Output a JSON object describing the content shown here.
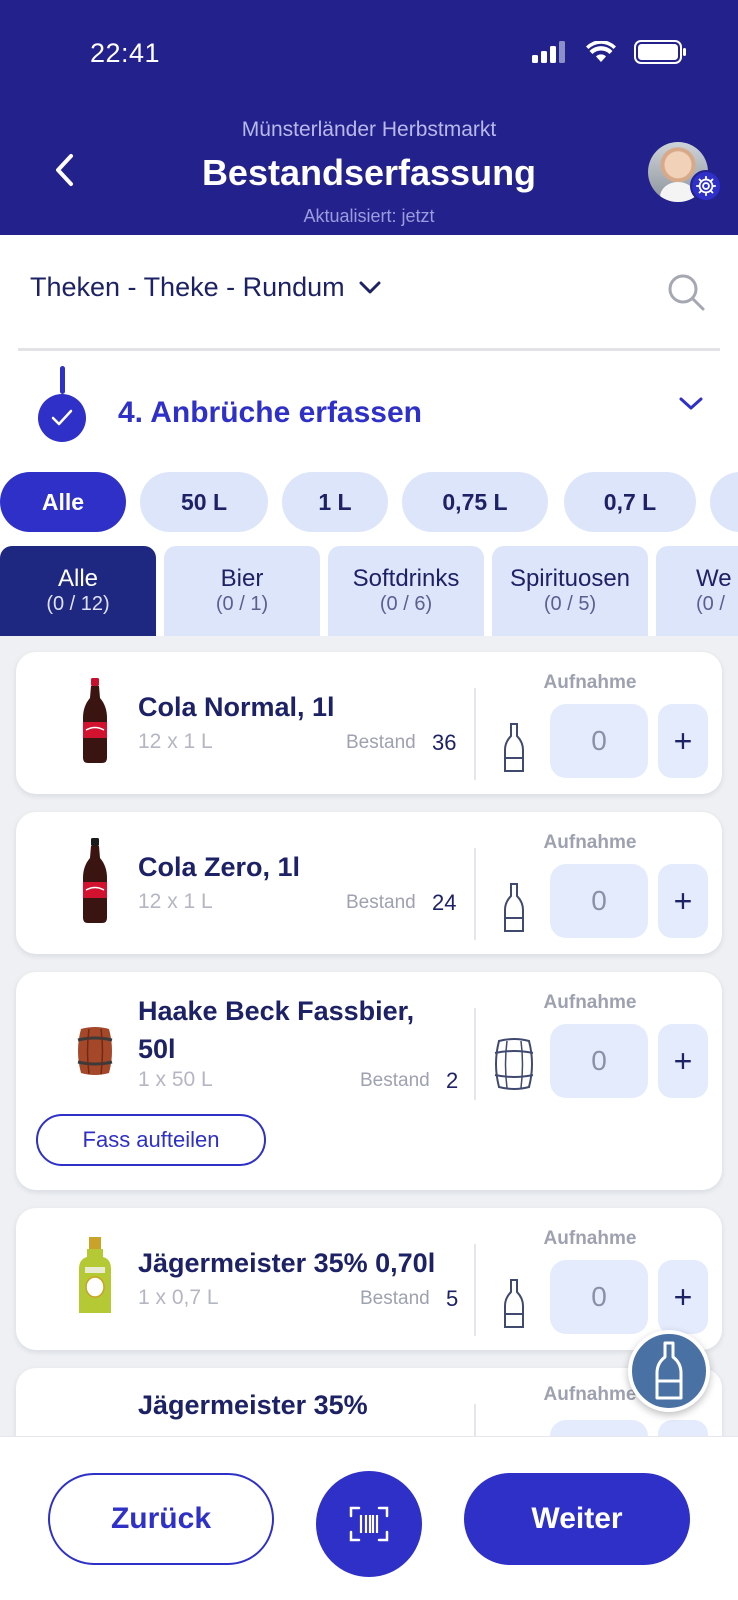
{
  "status_bar": {
    "time": "22:41"
  },
  "header": {
    "subtitle": "Münsterländer Herbstmarkt",
    "title": "Bestandserfassung",
    "updated": "Aktualisiert: jetzt"
  },
  "location": {
    "label": "Theken - Theke - Rundum"
  },
  "step": {
    "title": "4. Anbrüche erfassen",
    "completed": true
  },
  "size_filters": [
    {
      "label": "Alle",
      "active": true
    },
    {
      "label": "50 L",
      "active": false
    },
    {
      "label": "1 L",
      "active": false
    },
    {
      "label": "0,75 L",
      "active": false
    },
    {
      "label": "0,7 L",
      "active": false
    }
  ],
  "category_tabs": [
    {
      "label": "Alle",
      "count": "(0 / 12)",
      "active": true
    },
    {
      "label": "Bier",
      "count": "(0 / 1)",
      "active": false
    },
    {
      "label": "Softdrinks",
      "count": "(0 / 6)",
      "active": false
    },
    {
      "label": "Spirituosen",
      "count": "(0 / 5)",
      "active": false
    },
    {
      "label": "We",
      "count": "(0 /",
      "active": false
    }
  ],
  "products": [
    {
      "name": "Cola Normal, 1l",
      "pack": "12 x 1 L",
      "stock_label": "Bestand",
      "stock": "36",
      "aufnahme_label": "Aufnahme",
      "qty": "0",
      "plus": "+",
      "container": "bottle-icon",
      "image": "cola-bottle"
    },
    {
      "name": "Cola Zero, 1l",
      "pack": "12 x 1 L",
      "stock_label": "Bestand",
      "stock": "24",
      "aufnahme_label": "Aufnahme",
      "qty": "0",
      "plus": "+",
      "container": "bottle-icon",
      "image": "cola-bottle"
    },
    {
      "name": "Haake Beck Fassbier, 50l",
      "pack": "1 x 50 L",
      "stock_label": "Bestand",
      "stock": "2",
      "aufnahme_label": "Aufnahme",
      "qty": "0",
      "plus": "+",
      "container": "barrel-icon",
      "image": "barrel",
      "action": "Fass aufteilen"
    },
    {
      "name": "Jägermeister 35% 0,70l",
      "pack": "1 x 0,7 L",
      "stock_label": "Bestand",
      "stock": "5",
      "aufnahme_label": "Aufnahme",
      "qty": "0",
      "plus": "+",
      "container": "bottle-icon",
      "image": "jaeger-bottle"
    },
    {
      "name": "Jägermeister 35%",
      "aufnahme_label": "Aufnahme"
    }
  ],
  "bottom": {
    "back_label": "Zurück",
    "next_label": "Weiter"
  },
  "colors": {
    "primary": "#2e30c8",
    "header": "#23218c",
    "chip_bg": "#dde5fb",
    "active_tab": "#1f2880"
  }
}
